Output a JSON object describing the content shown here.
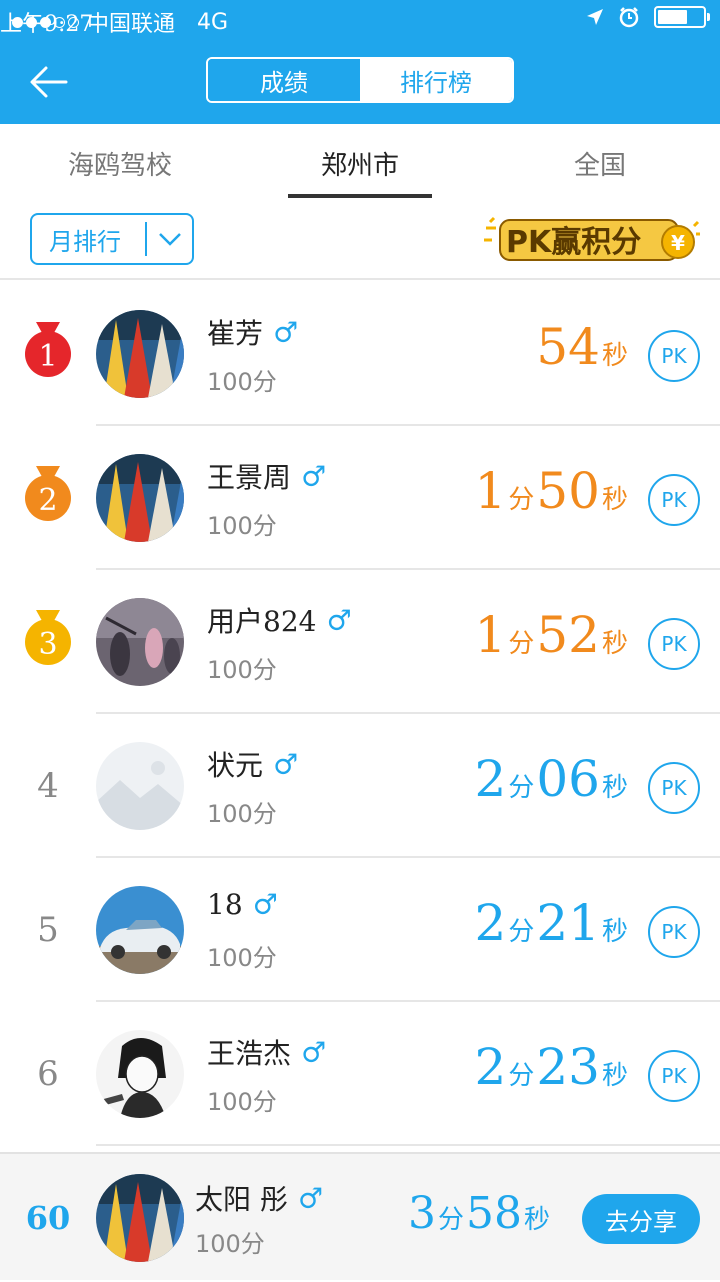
{
  "status": {
    "carrier": "中国联通",
    "network": "4G",
    "time": "上午9:27"
  },
  "header": {
    "back_icon": "back-arrow-icon",
    "segments": [
      "成绩",
      "排行榜"
    ],
    "active_segment": "成绩"
  },
  "tabs": [
    {
      "label": "海鸥驾校"
    },
    {
      "label": "郑州市"
    },
    {
      "label": "全国"
    }
  ],
  "active_tab": "郑州市",
  "filter": {
    "selected": "月排行",
    "pk_badge": "PK赢积分"
  },
  "rows": [
    {
      "rank": "1",
      "name": "崔芳",
      "gender": "♂",
      "score": "100分",
      "time": [
        "54",
        "秒"
      ],
      "pk": "PK"
    },
    {
      "rank": "2",
      "name": "王景周",
      "gender": "♂",
      "score": "100分",
      "time": [
        "1",
        "分",
        "50",
        "秒"
      ],
      "pk": "PK"
    },
    {
      "rank": "3",
      "name": "用户824",
      "gender": "♂",
      "score": "100分",
      "time": [
        "1",
        "分",
        "52",
        "秒"
      ],
      "pk": "PK"
    },
    {
      "rank": "4",
      "name": "状元",
      "gender": "♂",
      "score": "100分",
      "time": [
        "2",
        "分",
        "06",
        "秒"
      ],
      "pk": "PK"
    },
    {
      "rank": "5",
      "name": "18",
      "gender": "♂",
      "score": "100分",
      "time": [
        "2",
        "分",
        "21",
        "秒"
      ],
      "pk": "PK"
    },
    {
      "rank": "6",
      "name": "王浩杰",
      "gender": "♂",
      "score": "100分",
      "time": [
        "2",
        "分",
        "23",
        "秒"
      ],
      "pk": "PK"
    }
  ],
  "me": {
    "rank": "60",
    "name": "太阳 彤",
    "gender": "♂",
    "score": "100分",
    "time": [
      "3",
      "分",
      "58",
      "秒"
    ],
    "share_label": "去分享"
  },
  "colors": {
    "primary": "#1fa6ec",
    "orange": "#f18a1d",
    "gold": "#f5b400",
    "red": "#e5262b"
  }
}
